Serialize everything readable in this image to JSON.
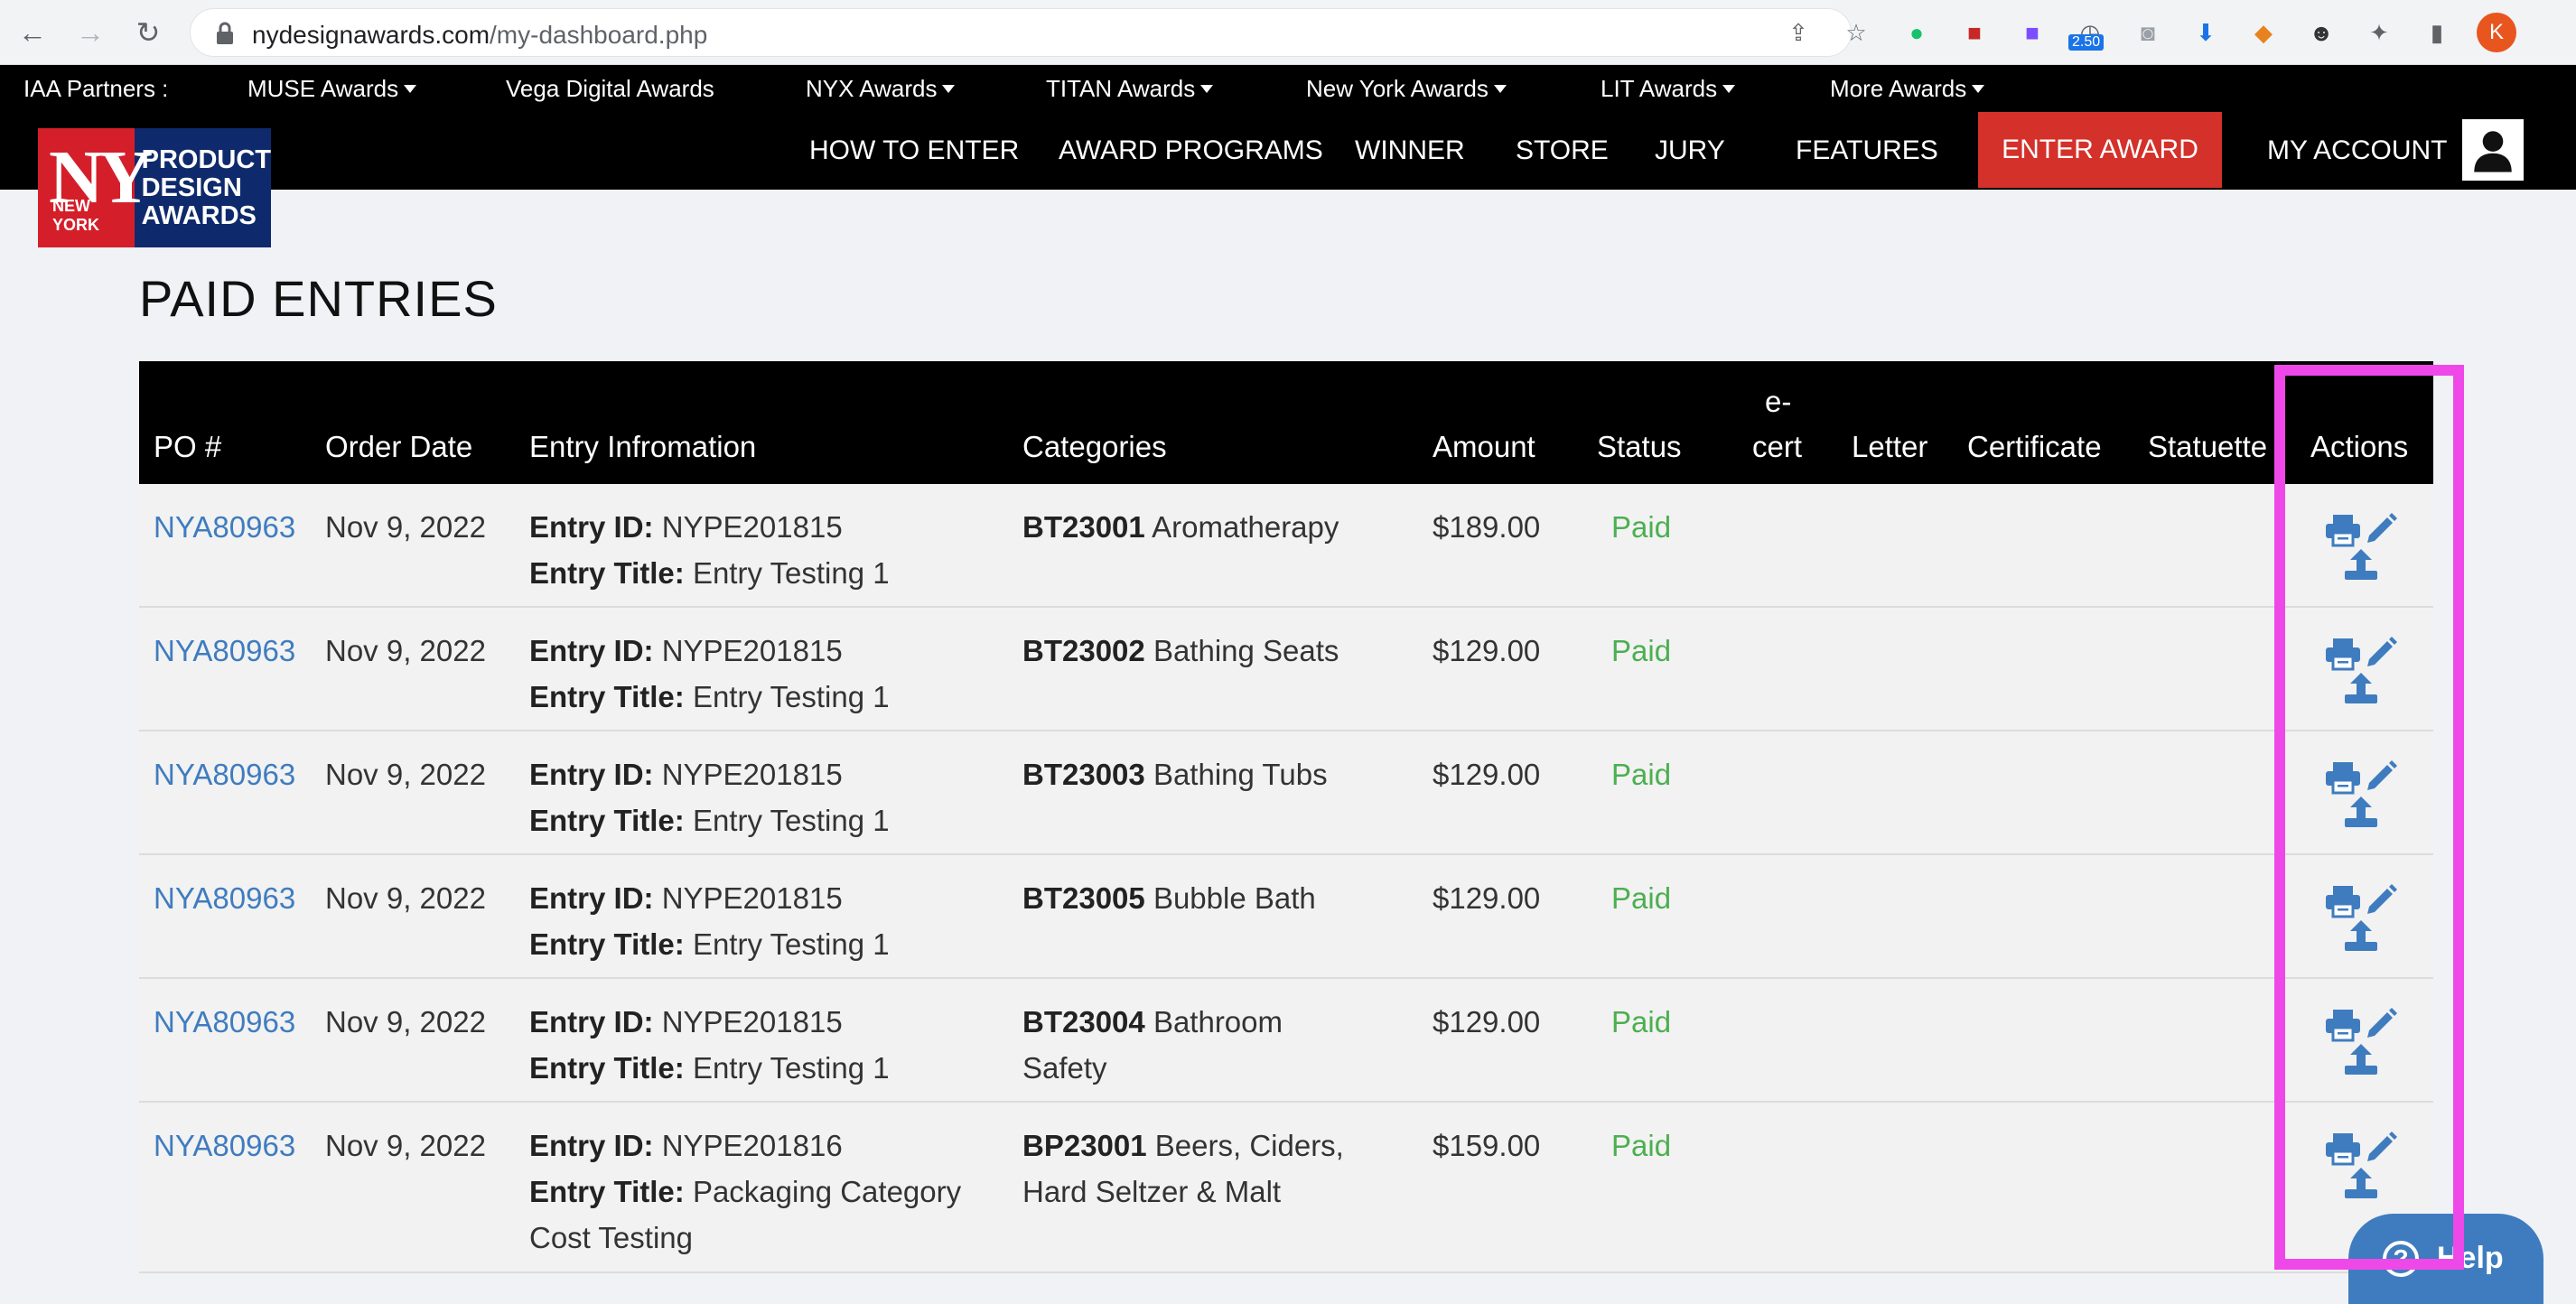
{
  "browser": {
    "url_domain": "nydesignawards.com",
    "url_path": "/my-dashboard.php",
    "profile_initial": "K",
    "ext_badge": "2.50"
  },
  "partners_bar": {
    "label": "IAA Partners :",
    "items": [
      "MUSE Awards",
      "Vega Digital Awards",
      "NYX Awards",
      "TITAN Awards",
      "New York Awards",
      "LIT Awards",
      "More Awards"
    ]
  },
  "logo": {
    "ny": "NY",
    "city": "NEW YORK",
    "line1": "PRODUCT",
    "line2": "DESIGN",
    "line3": "AWARDS"
  },
  "main_nav": {
    "items": [
      "HOW TO ENTER",
      "AWARD PROGRAMS",
      "WINNER",
      "STORE",
      "JURY",
      "FEATURES"
    ],
    "enter_award": "ENTER AWARD",
    "my_account": "MY ACCOUNT"
  },
  "page_title": "PAID ENTRIES",
  "table": {
    "headers": {
      "po": "PO #",
      "order_date": "Order Date",
      "entry_info": "Entry Infromation",
      "categories": "Categories",
      "amount": "Amount",
      "status": "Status",
      "ecert_1": "e-",
      "ecert_2": "cert",
      "letter": "Letter",
      "certificate": "Certificate",
      "statuette": "Statuette",
      "actions": "Actions"
    },
    "entry_id_label": "Entry ID:",
    "entry_title_label": "Entry Title:",
    "rows": [
      {
        "po": "NYA80963",
        "date": "Nov 9, 2022",
        "entry_id": "NYPE201815",
        "title_1": "Entry Testing 1",
        "title_2": "",
        "cat_code": "BT23001",
        "cat_1": "Aromatherapy",
        "cat_2": "",
        "amount": "$189.00",
        "status": "Paid"
      },
      {
        "po": "NYA80963",
        "date": "Nov 9, 2022",
        "entry_id": "NYPE201815",
        "title_1": "Entry Testing 1",
        "title_2": "",
        "cat_code": "BT23002",
        "cat_1": "Bathing Seats",
        "cat_2": "",
        "amount": "$129.00",
        "status": "Paid"
      },
      {
        "po": "NYA80963",
        "date": "Nov 9, 2022",
        "entry_id": "NYPE201815",
        "title_1": "Entry Testing 1",
        "title_2": "",
        "cat_code": "BT23003",
        "cat_1": "Bathing Tubs",
        "cat_2": "",
        "amount": "$129.00",
        "status": "Paid"
      },
      {
        "po": "NYA80963",
        "date": "Nov 9, 2022",
        "entry_id": "NYPE201815",
        "title_1": "Entry Testing 1",
        "title_2": "",
        "cat_code": "BT23005",
        "cat_1": "Bubble Bath",
        "cat_2": "",
        "amount": "$129.00",
        "status": "Paid"
      },
      {
        "po": "NYA80963",
        "date": "Nov 9, 2022",
        "entry_id": "NYPE201815",
        "title_1": "Entry Testing 1",
        "title_2": "",
        "cat_code": "BT23004",
        "cat_1": "Bathroom",
        "cat_2": "Safety",
        "amount": "$129.00",
        "status": "Paid"
      },
      {
        "po": "NYA80963",
        "date": "Nov 9, 2022",
        "entry_id": "NYPE201816",
        "title_1": "Packaging Category",
        "title_2": "Cost Testing",
        "cat_code": "BP23001",
        "cat_1": "Beers, Ciders,",
        "cat_2": "Hard Seltzer & Malt",
        "amount": "$159.00",
        "status": "Paid"
      }
    ]
  },
  "help_button": {
    "label": "Help",
    "q": "?"
  },
  "colors": {
    "accent_pink": "#ee49e8",
    "link_blue": "#3f7cbf",
    "paid_green": "#4caf50",
    "enter_red": "#d3312a"
  }
}
